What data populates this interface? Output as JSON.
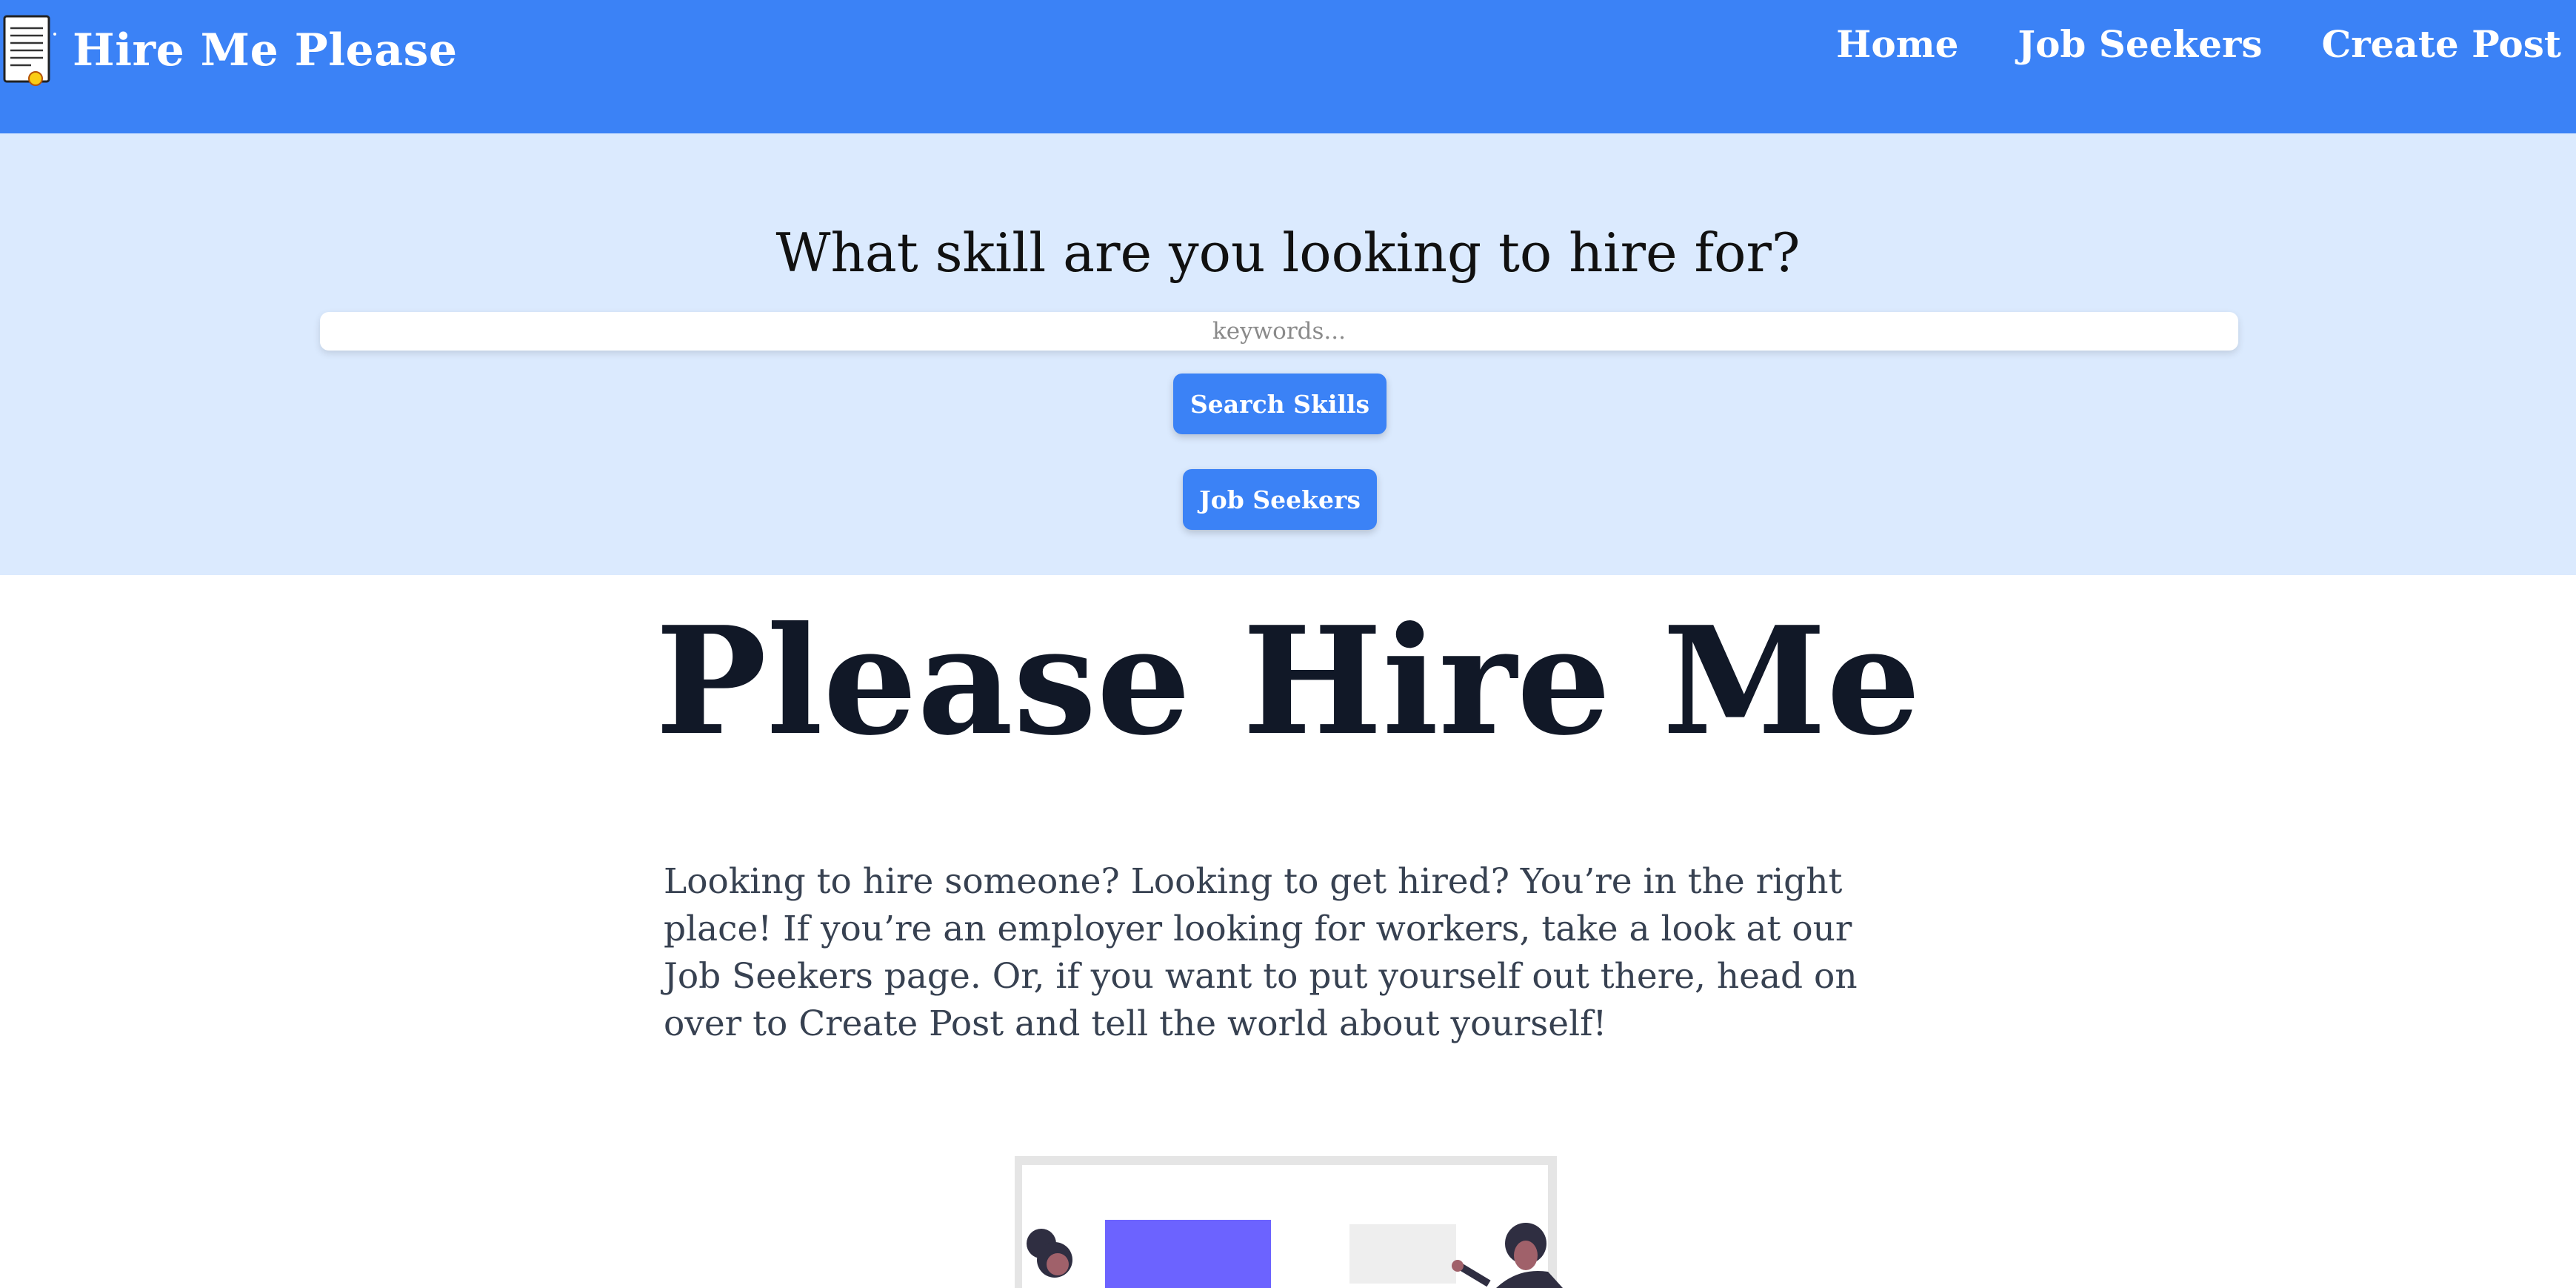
{
  "navbar": {
    "brand": "Hire Me Please",
    "logo_icon": "certificate-document-icon",
    "links": [
      {
        "label": "Home"
      },
      {
        "label": "Job Seekers"
      },
      {
        "label": "Create Post"
      }
    ]
  },
  "hero": {
    "question": "What skill are you looking to hire for?",
    "search_placeholder": "keywords...",
    "search_value": "",
    "search_button": "Search Skills",
    "seekers_button": "Job Seekers"
  },
  "main": {
    "title": "Please Hire Me",
    "intro": "Looking to hire someone? Looking to get hired? You’re in the right place! If you’re an employer looking for workers, take a look at our Job Seekers page. Or, if you want to put yourself out there, head on over to Create Post and tell the world about yourself!",
    "illustration_icon": "presentation-people-illustration"
  },
  "colors": {
    "primary": "#3b82f6",
    "hero_bg": "#dbeafe",
    "title_text": "#111827",
    "body_text": "#374151",
    "illustration_accent": "#6c63ff"
  }
}
